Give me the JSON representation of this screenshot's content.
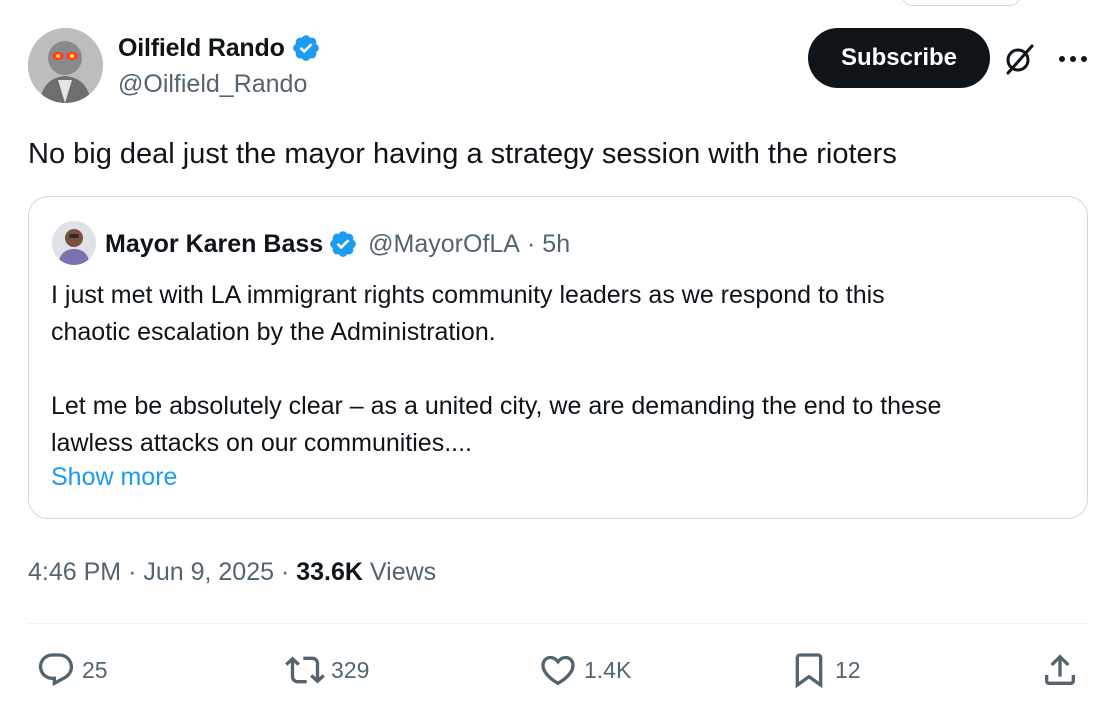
{
  "author": {
    "name": "Oilfield Rando",
    "handle": "@Oilfield_Rando",
    "verified": true
  },
  "header": {
    "subscribe_label": "Subscribe",
    "grok_icon": "grok-icon",
    "more_icon": "more-horizontal-icon"
  },
  "tweet": {
    "text": "No big deal just the mayor having a strategy session with the rioters"
  },
  "quote": {
    "name": "Mayor Karen Bass",
    "handle": "@MayorOfLA",
    "separator": "·",
    "time": "5h",
    "paragraph1_line1": "I just met with LA immigrant rights community leaders as we respond to this",
    "paragraph1_line2": "chaotic escalation by the Administration.",
    "paragraph2_line1": "Let me be absolutely clear – as a united city, we are demanding the end to these",
    "paragraph2_line2": "lawless attacks on our communities....",
    "show_more": "Show more"
  },
  "meta": {
    "time": "4:46 PM",
    "separator": "·",
    "date": "Jun 9, 2025",
    "views_count": "33.6K",
    "views_label": "Views"
  },
  "actions": {
    "replies": "25",
    "reposts": "329",
    "likes": "1.4K",
    "bookmarks": "12"
  },
  "colors": {
    "text": "#0f1419",
    "secondary": "#536471",
    "link": "#1d9bf0",
    "verified": "#1d9bf0",
    "border": "#cfd9de",
    "button_bg": "#0f1419"
  }
}
